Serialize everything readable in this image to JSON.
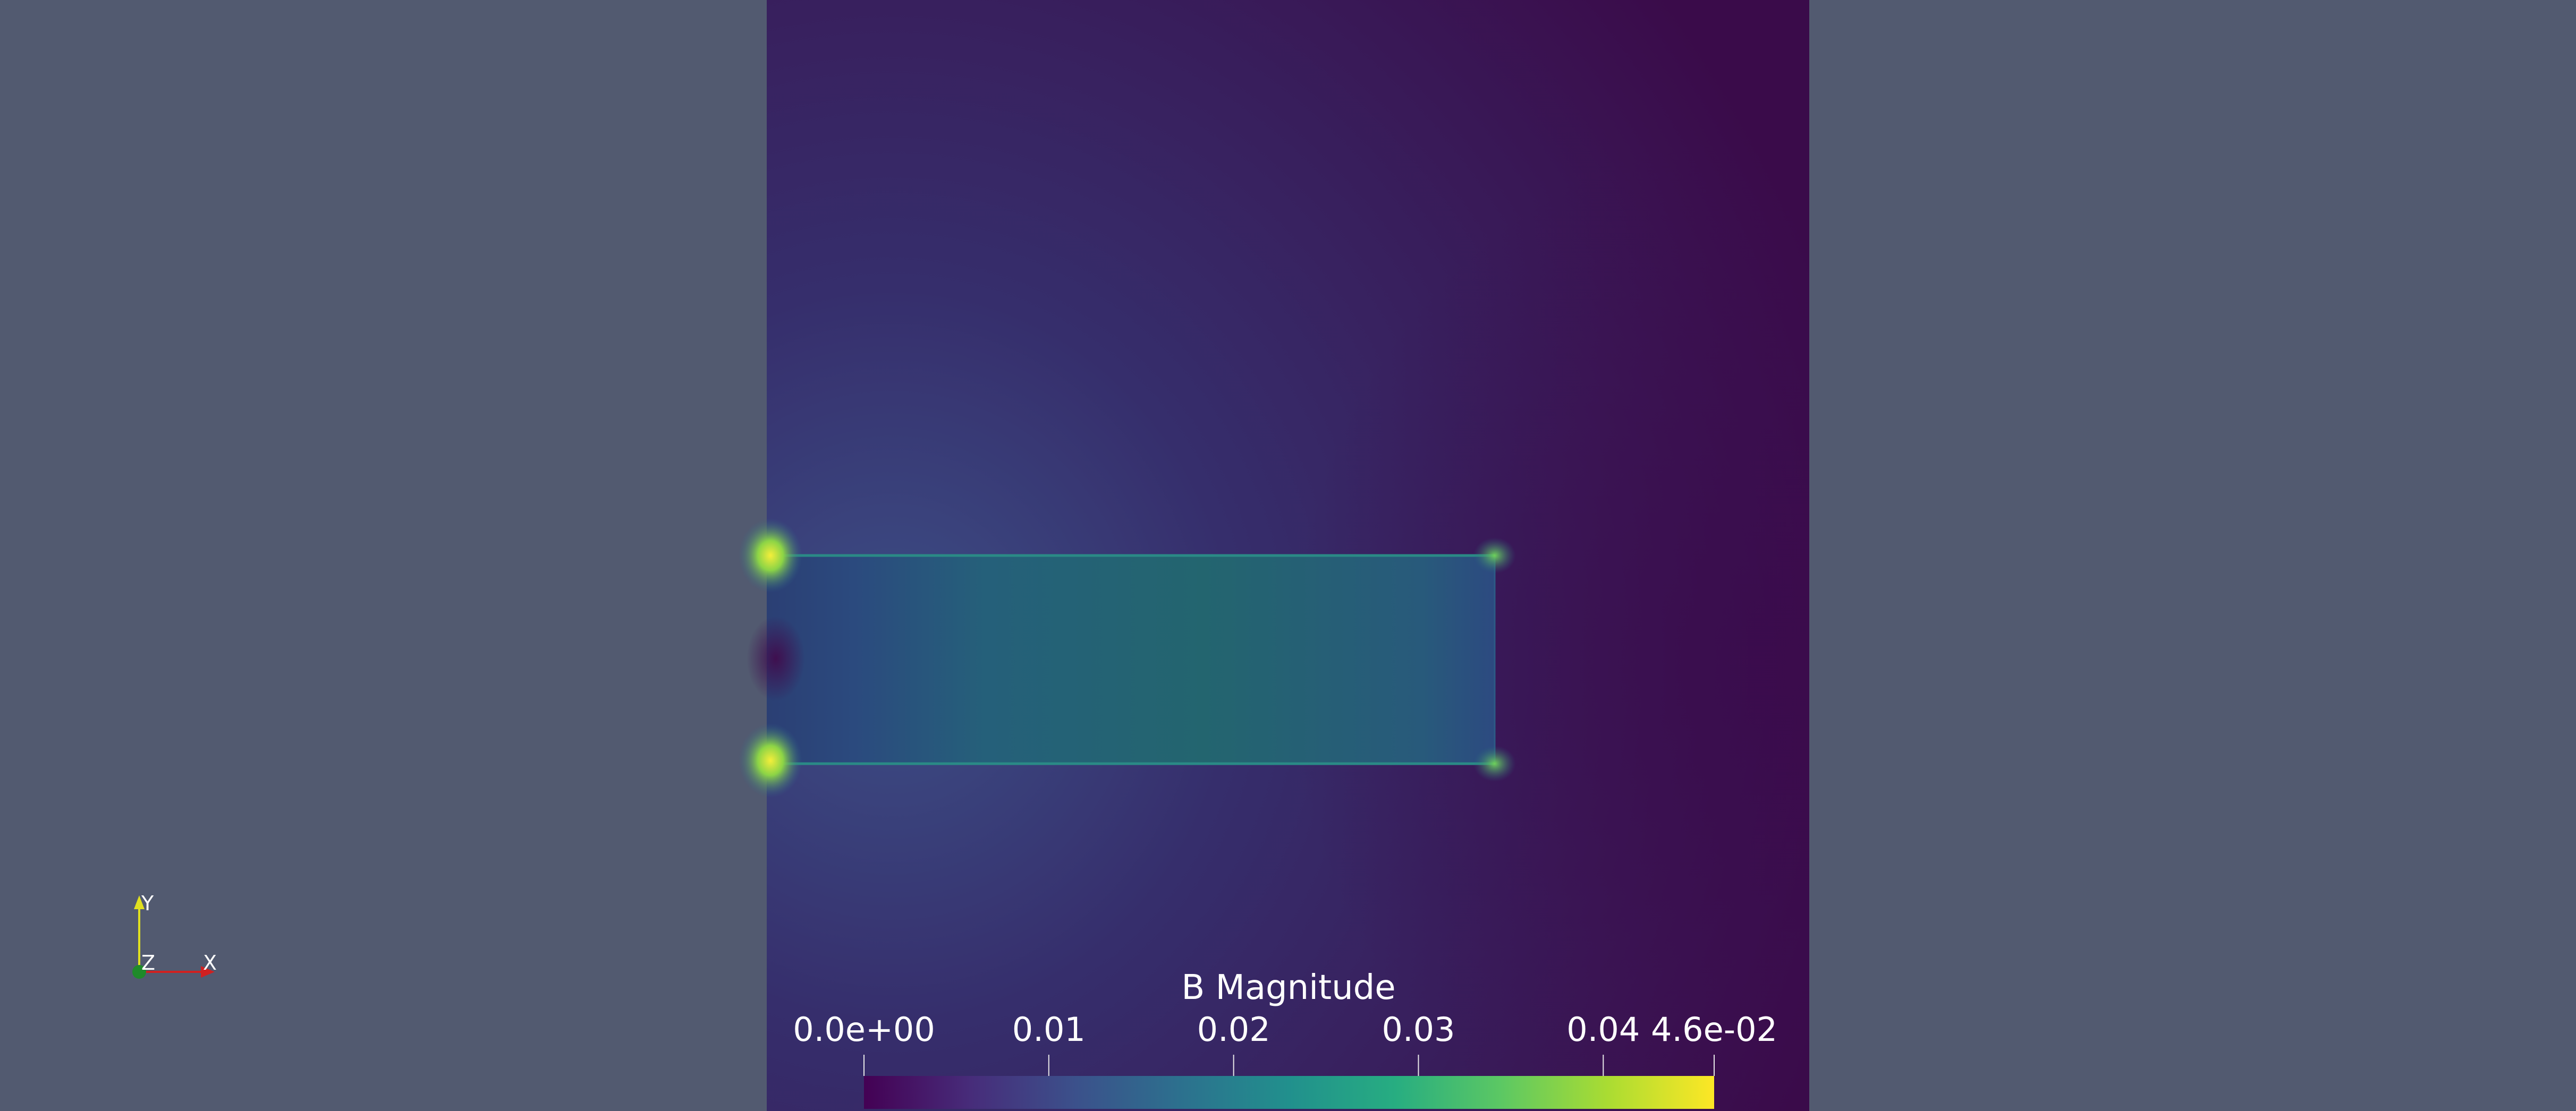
{
  "colors": {
    "background": "#525a70",
    "field_dark": "#3a0c4a",
    "field_mid": "#2f3a6e",
    "bar_region": "#24606c",
    "hotspot": "#d6e22a",
    "x_axis": "#d02020",
    "y_axis": "#e0e020",
    "z_axis": "#1f8a2a"
  },
  "colorbar": {
    "title": "B Magnitude",
    "min_label": "0.0e+00",
    "max_label": "4.6e-02",
    "min_value": 0.0,
    "max_value": 0.046,
    "ticks": [
      {
        "value": 0.0,
        "label": "0.0e+00"
      },
      {
        "value": 0.01,
        "label": "0.01"
      },
      {
        "value": 0.02,
        "label": "0.02"
      },
      {
        "value": 0.03,
        "label": "0.03"
      },
      {
        "value": 0.04,
        "label": "0.04"
      },
      {
        "value": 0.046,
        "label": "4.6e-02"
      }
    ],
    "colormap": "viridis",
    "stops": [
      "#440154",
      "#472c7a",
      "#3b518b",
      "#2c718e",
      "#21908d",
      "#27ad81",
      "#5cc863",
      "#aadc32",
      "#fde725"
    ]
  },
  "orientation_axes": {
    "x_label": "X",
    "y_label": "Y",
    "z_label": "Z"
  }
}
